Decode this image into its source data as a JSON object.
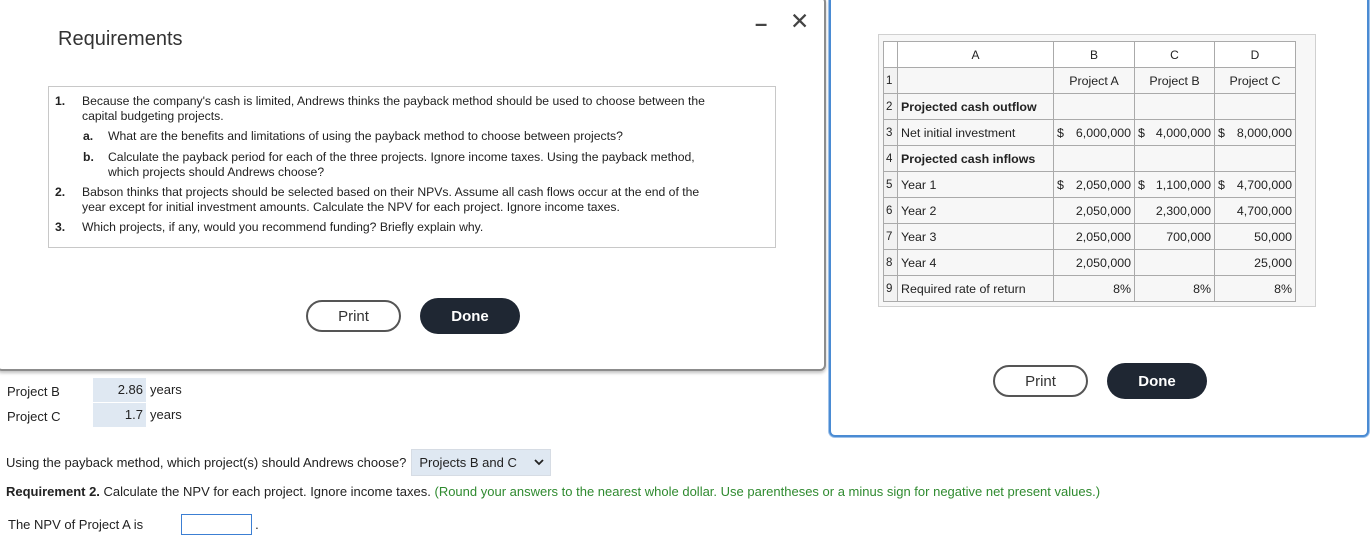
{
  "background": {
    "rows": [
      {
        "label": "Project B",
        "value": "2.86",
        "unit": "years"
      },
      {
        "label": "Project C",
        "value": "1.7",
        "unit": "years"
      }
    ],
    "payback_question": "Using the payback method, which project(s) should Andrews choose?",
    "payback_selected": "Projects B and C",
    "req2_bold": "Requirement 2.",
    "req2_text": " Calculate the NPV for each project. Ignore income taxes.",
    "req2_hint": " (Round your answers to the nearest whole dollar. Use parentheses or a minus sign for negative net present values.)",
    "npv_label": "The NPV of Project A is",
    "npv_suffix": "."
  },
  "requirements_dialog": {
    "title": "Requirements",
    "minimize_icon": "minimize-icon",
    "close_icon": "close-icon",
    "items": {
      "n1": "1.",
      "t1a": "Because the company's cash is limited, Andrews thinks the payback method should be used to choose between the",
      "t1b": "capital budgeting projects.",
      "na": "a.",
      "ta": "What are the benefits and limitations of using the payback method to choose between projects?",
      "nb": "b.",
      "tb1": "Calculate the payback period for each of the three projects. Ignore income taxes. Using the payback method,",
      "tb2": "which projects should Andrews choose?",
      "n2": "2.",
      "t2a": "Babson thinks that projects should be selected based on their NPVs. Assume all cash flows occur at the end of the",
      "t2b": "year except for initial investment amounts. Calculate the NPV for each project. Ignore income taxes.",
      "n3": "3.",
      "t3": "Which projects, if any, would you recommend funding? Briefly explain why."
    },
    "print_label": "Print",
    "done_label": "Done"
  },
  "data_dialog": {
    "print_label": "Print",
    "done_label": "Done",
    "columns": [
      "A",
      "B",
      "C",
      "D"
    ],
    "rows": [
      {
        "n": "1",
        "a": "",
        "b": "Project A",
        "c": "Project B",
        "d": "Project C"
      },
      {
        "n": "2",
        "a": "Projected cash outflow",
        "b": "",
        "c": "",
        "d": ""
      },
      {
        "n": "3",
        "a": "Net initial investment",
        "b": "6,000,000",
        "c": "4,000,000",
        "d": "8,000,000"
      },
      {
        "n": "4",
        "a": "Projected cash inflows",
        "b": "",
        "c": "",
        "d": ""
      },
      {
        "n": "5",
        "a": "Year 1",
        "b": "2,050,000",
        "c": "1,100,000",
        "d": "4,700,000"
      },
      {
        "n": "6",
        "a": "Year 2",
        "b": "2,050,000",
        "c": "2,300,000",
        "d": "4,700,000"
      },
      {
        "n": "7",
        "a": "Year 3",
        "b": "2,050,000",
        "c": "700,000",
        "d": "50,000"
      },
      {
        "n": "8",
        "a": "Year 4",
        "b": "2,050,000",
        "c": "",
        "d": "25,000"
      },
      {
        "n": "9",
        "a": "Required rate of return",
        "b": "8%",
        "c": "8%",
        "d": "8%"
      }
    ],
    "currency": "$"
  }
}
